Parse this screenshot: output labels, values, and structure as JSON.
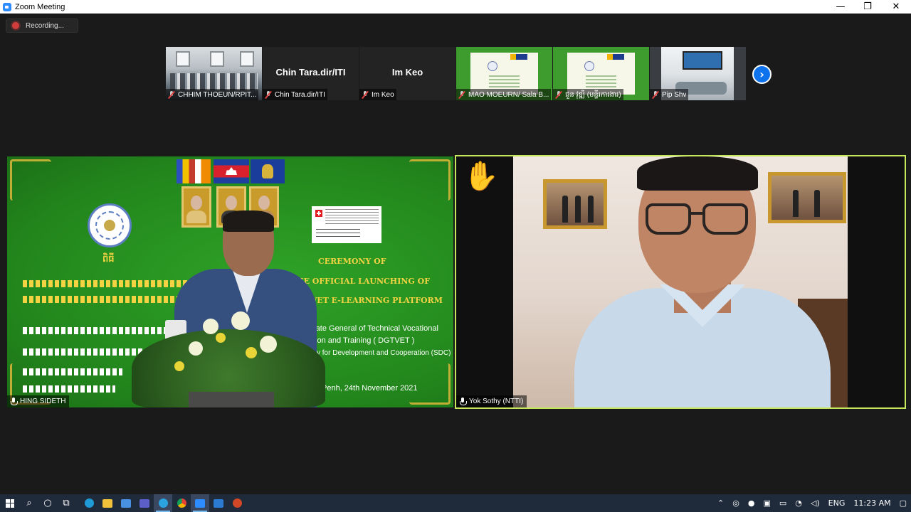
{
  "window": {
    "title": "Zoom Meeting",
    "minimize": "—",
    "maximize": "❐",
    "close": "✕"
  },
  "recording": {
    "label": "Recording..."
  },
  "participants_strip": [
    {
      "name": "CHHIM THOEUN/RPIT...",
      "muted": true,
      "display": "video"
    },
    {
      "name": "Chin Tara.dir/ITI",
      "muted": true,
      "display": "name",
      "big_name": "Chin Tara.dir/ITI"
    },
    {
      "name": "Im Keo",
      "muted": true,
      "display": "name",
      "big_name": "Im Keo"
    },
    {
      "name": "MAO MOEURN/ Sala B...",
      "muted": true,
      "display": "video"
    },
    {
      "name": "ជួន វុឌ្ឍី (មន្ទីរការងារ)",
      "muted": true,
      "display": "video"
    },
    {
      "name": "Pip Shv",
      "muted": true,
      "display": "video"
    }
  ],
  "strip_next_icon": "chevron-right",
  "main_left": {
    "name": "HING SIDETH",
    "slide": {
      "khmer_heading": "ពិធី",
      "title_line1": "CEREMONY OF",
      "title_line2": "THE OFFICIAL LAUNCHING OF",
      "title_line3": "L TVET E-LEARNING PLATFORM",
      "org_line1": "rate General of Technical Vocational",
      "org_line2": "tion and Training ( DGTVET )",
      "support_line": "cy for Development and Cooperation (SDC)",
      "date_line": "Penh, 24th November 2021"
    }
  },
  "main_right": {
    "name": "Yok Sothy (NTTI)",
    "raise_hand": "✋"
  },
  "taskbar": {
    "language": "ENG",
    "time": "11:23 AM"
  },
  "colors": {
    "accent": "#0e72ed",
    "active_speaker_border": "#c6e65c",
    "slide_green": "#2a8a23",
    "slide_gold": "#f3d342"
  }
}
